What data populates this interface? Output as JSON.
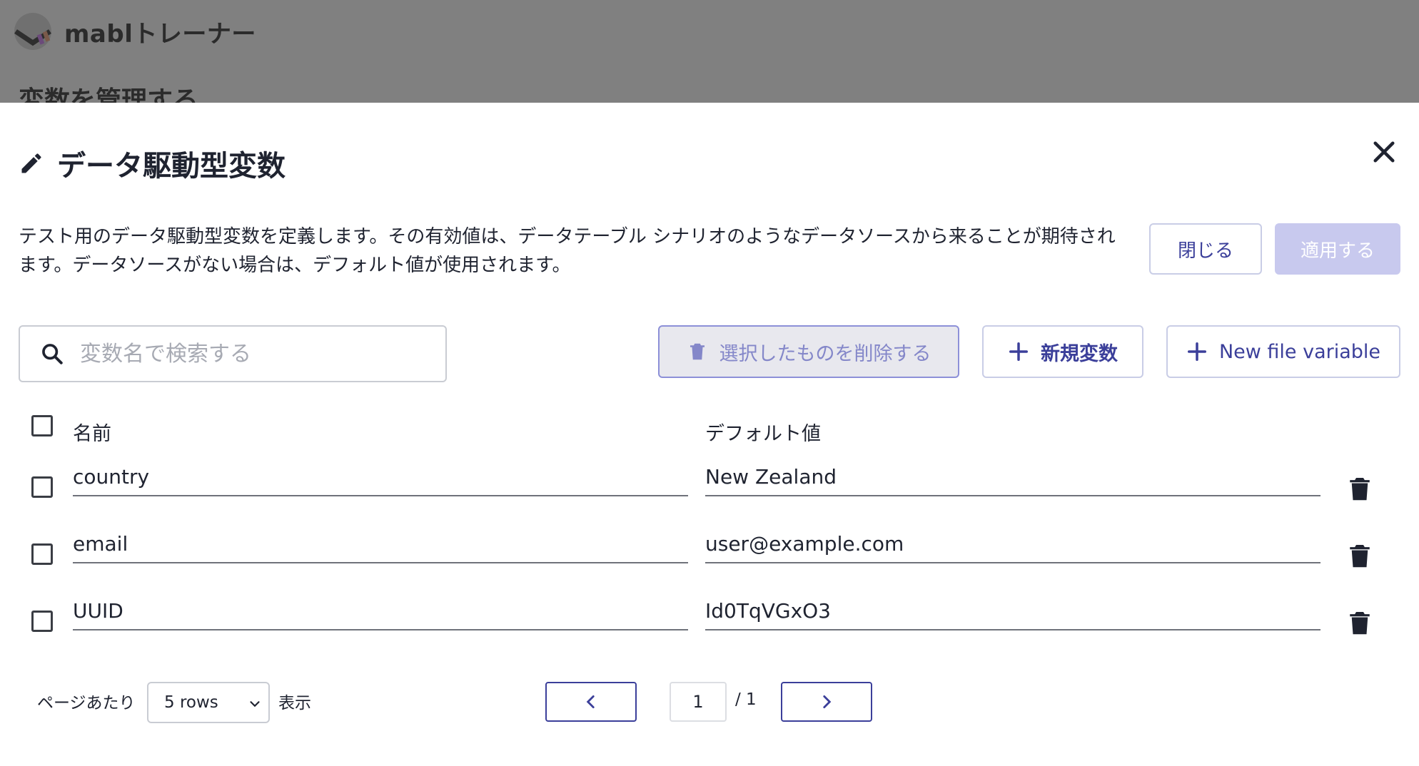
{
  "app": {
    "title": "mablトレーナー",
    "background_heading": "変数を管理する"
  },
  "modal": {
    "title": "データ駆動型変数",
    "description": "テスト用のデータ駆動型変数を定義します。その有効値は、データテーブル シナリオのようなデータソースから来ることが期待されます。データソースがない場合は、デフォルト値が使用されます。",
    "close_label": "閉じる",
    "apply_label": "適用する"
  },
  "toolbar": {
    "search_placeholder": "変数名で検索する",
    "delete_selected_label": "選択したものを削除する",
    "new_variable_label": "新規変数",
    "new_file_variable_label": "New file variable"
  },
  "table": {
    "name_header": "名前",
    "default_header": "デフォルト値",
    "rows": [
      {
        "name": "country",
        "default": "New Zealand"
      },
      {
        "name": "email",
        "default": "user@example.com"
      },
      {
        "name": "UUID",
        "default": "Id0TqVGxO3"
      }
    ]
  },
  "pagination": {
    "per_page_label": "ページあたり",
    "rows_option": "5 rows",
    "display_label": "表示",
    "current_page": "1",
    "total_pages": "/ 1"
  },
  "colors": {
    "accent": "#3b3f9a",
    "apply_disabled": "#c8c9ee",
    "overlay": "#808080"
  }
}
